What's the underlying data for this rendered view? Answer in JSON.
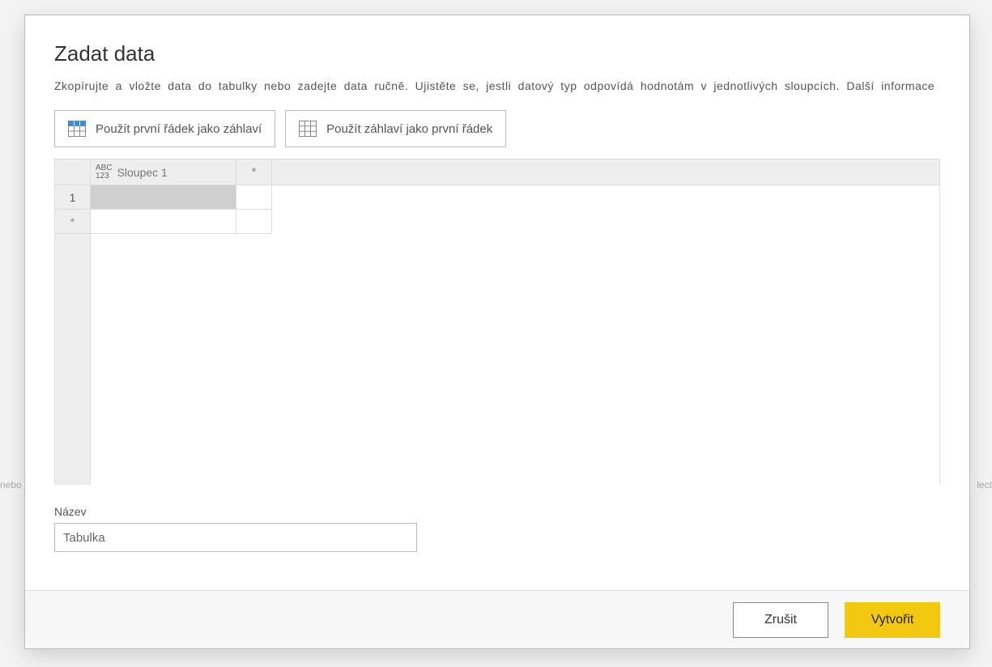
{
  "background": {
    "left_snippet": "nebo",
    "right_snippet": "lect"
  },
  "dialog": {
    "title": "Zadat data",
    "subtitle_main": "Zkopírujte a vložte data do tabulky nebo zadejte data ručně. Ujistěte se, jestli datový typ odpovídá hodnotám v jednotlivých sloupcích.",
    "subtitle_link": "Další informace",
    "toolbar": {
      "use_first_row_as_header": "Použít první řádek jako záhlaví",
      "use_header_as_first_row": "Použít záhlaví jako první řádek"
    },
    "grid": {
      "column_type_line1": "ABC",
      "column_type_line2": "123",
      "column1_name": "Sloupec 1",
      "add_col_symbol": "*",
      "row1_number": "1",
      "add_row_symbol": "*"
    },
    "name_field": {
      "label": "Název",
      "value": "Tabulka"
    },
    "footer": {
      "cancel": "Zrušit",
      "create": "Vytvořit"
    }
  }
}
